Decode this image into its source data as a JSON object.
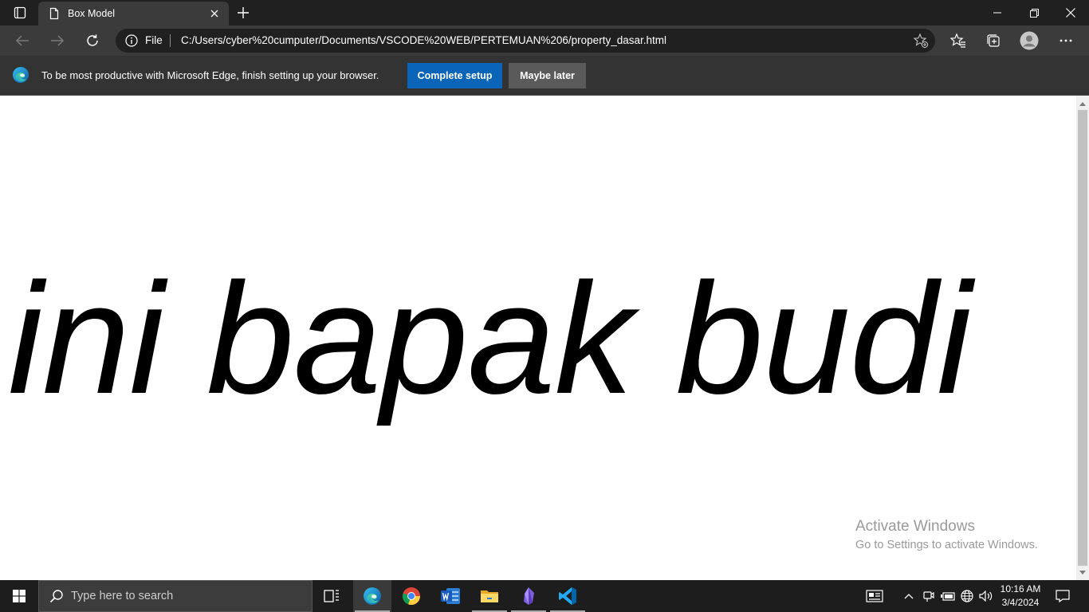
{
  "browser": {
    "tab_title": "Box Model",
    "address_scheme": "File",
    "address_url": "C:/Users/cyber%20cumputer/Documents/VSCODE%20WEB/PERTEMUAN%206/property_dasar.html",
    "accent": "#0a64b7"
  },
  "infobar": {
    "message": "To be most productive with Microsoft Edge, finish setting up your browser.",
    "primary_label": "Complete setup",
    "secondary_label": "Maybe later"
  },
  "page": {
    "heading": "ini bapak budi"
  },
  "watermark": {
    "line1": "Activate Windows",
    "line2": "Go to Settings to activate Windows."
  },
  "taskbar": {
    "search_placeholder": "Type here to search",
    "apps": [
      "task-view",
      "edge",
      "chrome",
      "word",
      "file-explorer",
      "obsidian",
      "vscode"
    ],
    "time": "10:16 AM",
    "date": "3/4/2024"
  }
}
